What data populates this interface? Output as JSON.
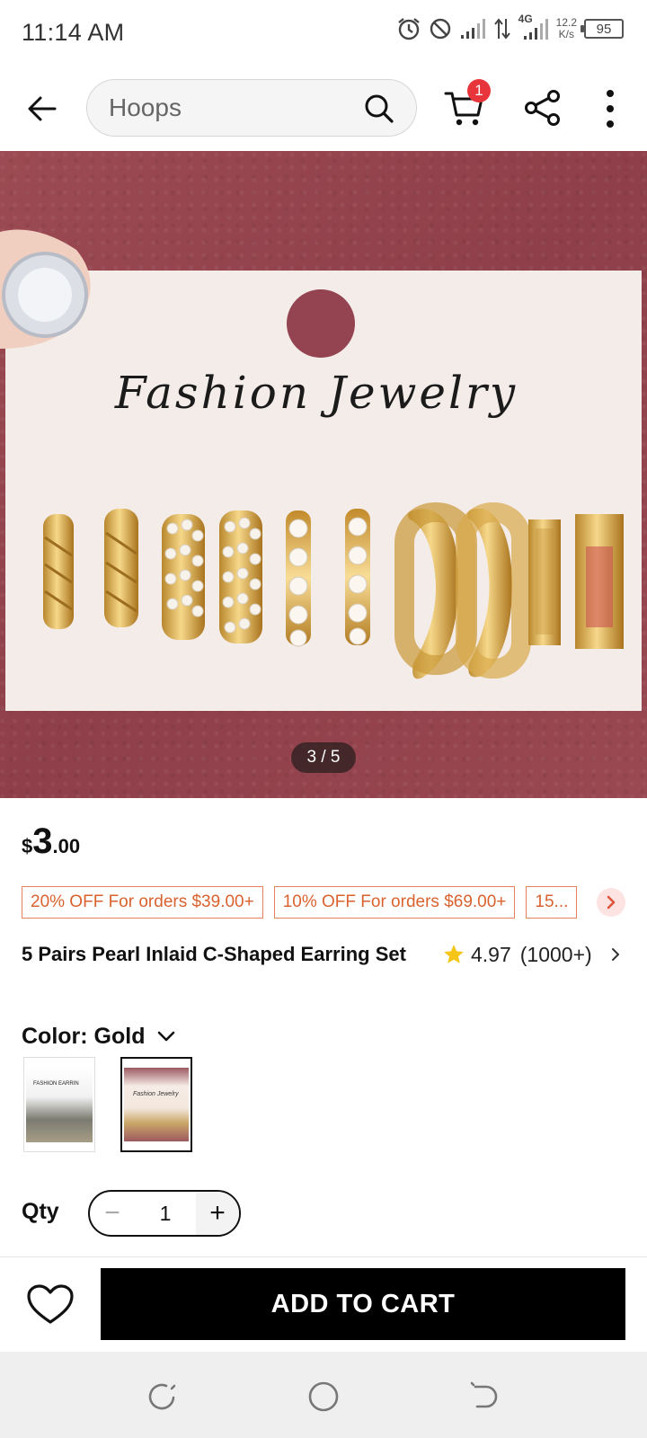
{
  "status_bar": {
    "time": "11:14 AM",
    "network_type": "4G",
    "net_speed_value": "12.2",
    "net_speed_unit": "K/s",
    "battery": "95",
    "icons": [
      "alarm-icon",
      "dnd-icon",
      "signal-icon",
      "data-arrows-icon",
      "signal-4g-icon"
    ]
  },
  "header": {
    "search_value": "Hoops",
    "cart_badge": "1",
    "icons": [
      "back-arrow-icon",
      "search-icon",
      "cart-icon",
      "share-icon",
      "more-vertical-icon"
    ]
  },
  "gallery": {
    "counter": "3 / 5",
    "card_text": "Fashion Jewelry"
  },
  "product": {
    "price_currency": "$",
    "price_integer": "3",
    "price_decimal": ".00",
    "coupons": [
      "20% OFF For orders $39.00+",
      "10% OFF For orders $69.00+",
      "15..."
    ],
    "title": "5 Pairs Pearl Inlaid C-Shaped Earring Set",
    "rating": "4.97",
    "rating_count": "(1000+)",
    "color_label": "Color: Gold",
    "swatches": [
      {
        "name": "silver-variant",
        "selected": false,
        "caption": "FASHION EARRIN"
      },
      {
        "name": "gold-variant",
        "selected": true,
        "caption": "Fashion Jewelry"
      }
    ]
  },
  "qty": {
    "label": "Qty",
    "value": "1",
    "minus": "−",
    "plus": "+"
  },
  "actions": {
    "add_to_cart": "ADD TO CART"
  },
  "colors": {
    "accent": "#000000",
    "badge": "#e8353c",
    "coupon": "#d9622f",
    "star": "#f5c518",
    "image_bg": "#934450"
  }
}
